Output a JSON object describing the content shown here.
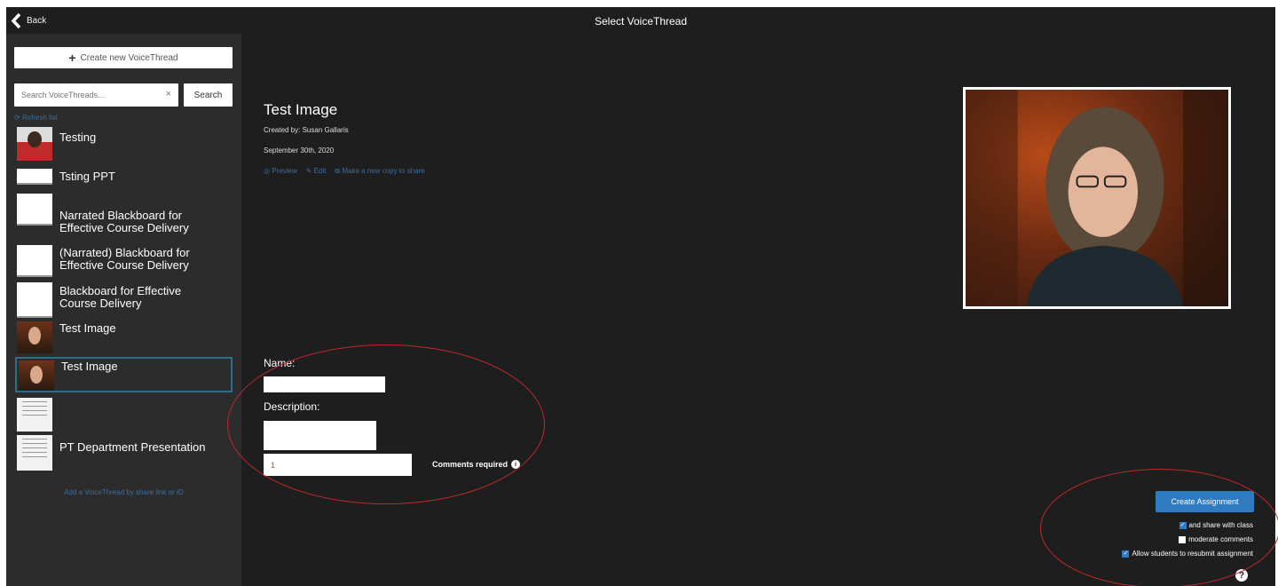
{
  "header": {
    "back_label": "Back",
    "title": "Select VoiceThread"
  },
  "sidebar": {
    "create_label": "Create new VoiceThread",
    "search_placeholder": "Search VoiceThreads...",
    "search_clear": "×",
    "search_button": "Search",
    "refresh_label": "Refresh list",
    "items": [
      {
        "label": "Testing",
        "thumb": "person"
      },
      {
        "label": "Tsting PPT",
        "thumb": "slide"
      },
      {
        "label": "Narrated Blackboard for Effective Course Delivery",
        "thumb": "slide"
      },
      {
        "label": "(Narrated) Blackboard for Effective Course Delivery",
        "thumb": "slide"
      },
      {
        "label": "Blackboard for Effective Course Delivery",
        "thumb": "slide"
      },
      {
        "label": "Test Image",
        "thumb": "portrait"
      },
      {
        "label": "Test Image",
        "thumb": "portrait",
        "selected": true
      },
      {
        "label": "PT Department Presentation",
        "thumb": "document"
      }
    ],
    "add_link": "Add a VoiceThread by share link or ID"
  },
  "detail": {
    "title": "Test Image",
    "created_by": "Created by: Susan Gallaris",
    "date": "September 30th, 2020",
    "actions": [
      "Preview",
      "Edit",
      "Make a new copy to share"
    ]
  },
  "form": {
    "name_label": "Name:",
    "name_value": "",
    "description_label": "Description:",
    "description_value": "",
    "comments_value": "1",
    "comments_label": "Comments required",
    "info_icon": "i"
  },
  "assignment": {
    "create_button": "Create Assignment",
    "options": [
      {
        "label": "and share with class",
        "checked": true
      },
      {
        "label": "moderate comments",
        "checked": false
      },
      {
        "label": "Allow students to resubmit assignment",
        "checked": true
      }
    ],
    "help_icon": "?"
  },
  "colors": {
    "background": "#1e1e1e",
    "sidebar": "#2c2c2c",
    "accent": "#2f7bbf",
    "link": "#3b6e9e",
    "annotation": "#c0272d"
  }
}
